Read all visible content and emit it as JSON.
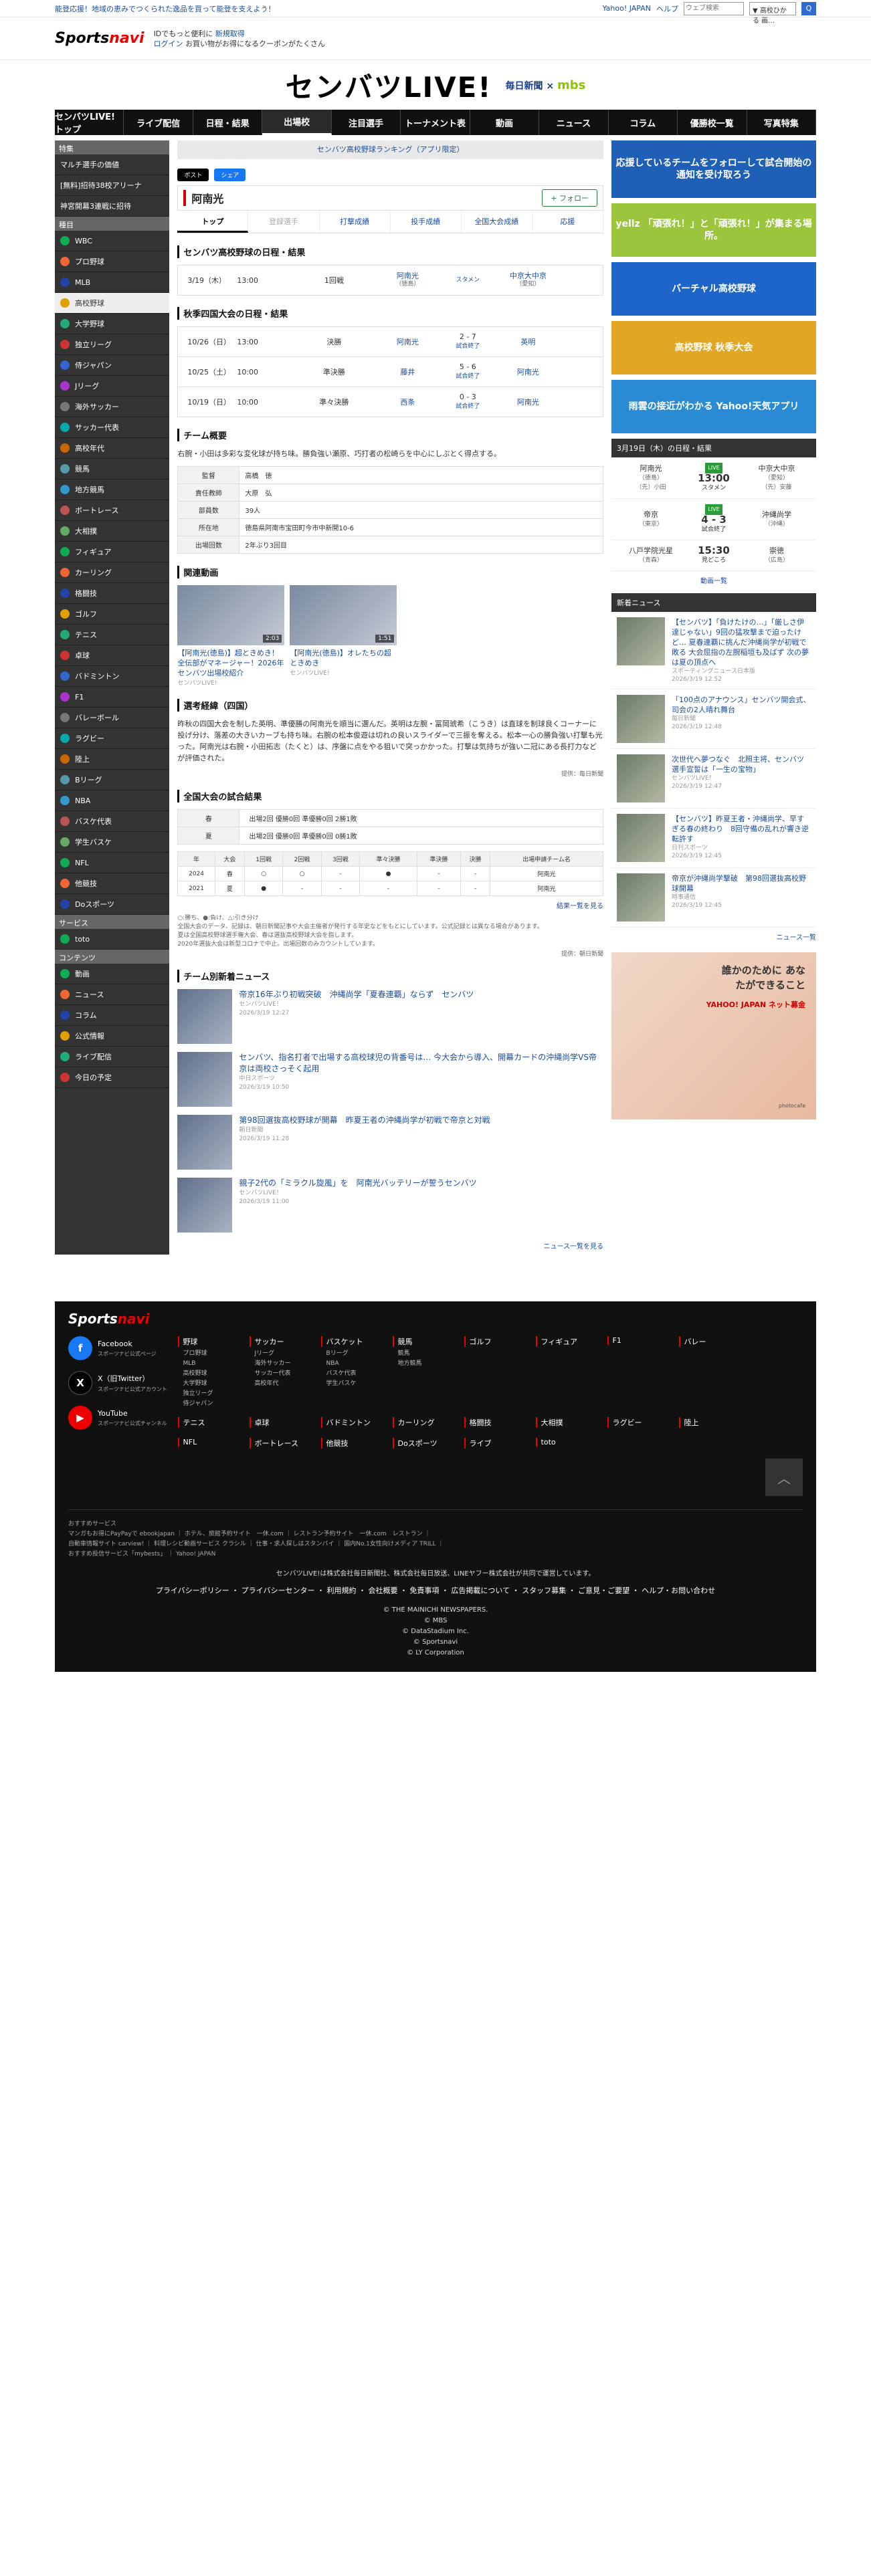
{
  "top": {
    "promo": "能登応援！地域の恵みでつくられた逸品を買って能登を支えよう！",
    "yahoo": "Yahoo! JAPAN",
    "help": "ヘルプ",
    "search_placeholder": "ウェブ検索",
    "search_scope": "▼ 高校ひかる 画…",
    "search_btn": "Q"
  },
  "logo_bar": {
    "logo_a": "Sports",
    "logo_b": "navi",
    "id_line1a": "IDでもっと便利に",
    "id_line1b": "新規取得",
    "id_line2a": "ログイン",
    "id_line2b": "お買い物がお得になるクーポンがたくさん"
  },
  "brand": {
    "title": "センバツLIVE!",
    "partner1": "毎日新聞",
    "times": "×",
    "partner2": "mbs"
  },
  "gnav": [
    "センバツLIVE!トップ",
    "ライブ配信",
    "日程・結果",
    "出場校",
    "注目選手",
    "トーナメント表",
    "動画",
    "ニュース",
    "コラム",
    "優勝校一覧",
    "写真特集"
  ],
  "gnav_active": "出場校",
  "sidebar": {
    "feature_hd": "特集",
    "feature": [
      "マルチ選手の価値",
      "[無料]招待38校アリーナ",
      "神宮開幕3連戦に招待"
    ],
    "sports_hd": "種目",
    "sports": [
      "WBC",
      "プロ野球",
      "MLB",
      "高校野球",
      "大学野球",
      "独立リーグ",
      "侍ジャパン",
      "Jリーグ",
      "海外サッカー",
      "サッカー代表",
      "高校年代",
      "競馬",
      "地方競馬",
      "ボートレース",
      "大相撲",
      "フィギュア",
      "カーリング",
      "格闘技",
      "ゴルフ",
      "テニス",
      "卓球",
      "バドミントン",
      "F1",
      "バレーボール",
      "ラグビー",
      "陸上",
      "Bリーグ",
      "NBA",
      "バスケ代表",
      "学生バスケ",
      "NFL",
      "他競技",
      "Doスポーツ"
    ],
    "sports_active": "高校野球",
    "service_hd": "サービス",
    "service": [
      "toto"
    ],
    "contents_hd": "コンテンツ",
    "contents": [
      "動画",
      "ニュース",
      "コラム",
      "公式情報",
      "ライブ配信",
      "今日の予定"
    ]
  },
  "main": {
    "ranking": "センバツ高校野球ランキング（アプリ限定）",
    "share_x": "ポスト",
    "share_fb": "シェア",
    "team": "阿南光",
    "follow": "+ フォロー",
    "tabs": [
      "トップ",
      "登録選手",
      "打撃成績",
      "投手成績",
      "全国大会成績",
      "応援"
    ],
    "sched_title": "センバツ高校野球の日程・結果",
    "sched": [
      {
        "date": "3/19（木）",
        "time": "13:00",
        "round": "1回戦",
        "home": "阿南光",
        "home_pref": "（徳島）",
        "score": "",
        "status": "スタメン",
        "away": "中京大中京",
        "away_pref": "（愛知）"
      }
    ],
    "fall_title": "秋季四国大会の日程・結果",
    "fall": [
      {
        "date": "10/26（日）",
        "time": "13:00",
        "round": "決勝",
        "home": "阿南光",
        "score": "2 - 7",
        "status": "試合終了",
        "away": "英明"
      },
      {
        "date": "10/25（土）",
        "time": "10:00",
        "round": "準決勝",
        "home": "藤井",
        "score": "5 - 6",
        "status": "試合終了",
        "away": "阿南光"
      },
      {
        "date": "10/19（日）",
        "time": "10:00",
        "round": "準々決勝",
        "home": "西条",
        "score": "0 - 3",
        "status": "試合終了",
        "away": "阿南光"
      }
    ],
    "summary_title": "チーム概要",
    "summary_desc": "右腕・小田は多彩な変化球が持ち味。勝負強い瀬原、巧打者の松崎らを中心にしぶとく得点する。",
    "info": [
      {
        "k": "監督",
        "v": "高橋　徳"
      },
      {
        "k": "責任教師",
        "v": "大原　弘"
      },
      {
        "k": "部員数",
        "v": "39人"
      },
      {
        "k": "所在地",
        "v": "徳島県阿南市宝田町今市中新開10-6"
      },
      {
        "k": "出場回数",
        "v": "2年ぶり3回目"
      }
    ],
    "videos_title": "関連動画",
    "videos": [
      {
        "title": "【阿南光(徳島)】超ときめき！全伝部がマネージャー！2026年センバツ出場校紹介",
        "src": "センバツLIVE!",
        "dur": "2:03"
      },
      {
        "title": "【阿南光(徳島)】オレたちの超ときめき",
        "src": "センバツLIVE!",
        "dur": "1:51"
      }
    ],
    "record_title": "選考経緯（四国）",
    "record": "昨秋の四国大会を制した英明、準優勝の阿南光を順当に選んだ。英明は左腕・冨岡琥希（こうき）は直球を制球良くコーナーに投げ分け、落差の大きいカーブも持ち味。右腕の松本俊遊は切れの良いスライダーで三振を奪える。松本一心の勝負強い打撃も光った。阿南光は右腕・小田拓志（たくと）は、序盤に点をやる狙いで突っかかった。打撃は気持ちが強い二冠にある長打力などが評価された。",
    "record_credit": "提供：毎日新聞",
    "natl_title": "全国大会の試合結果",
    "natl": [
      {
        "k": "春",
        "v": "出場2回 優勝0回 準優勝0回 2勝1敗"
      },
      {
        "k": "夏",
        "v": "出場2回 優勝0回 準優勝0回 0勝1敗"
      }
    ],
    "hist_head": [
      "年",
      "大会",
      "1回戦",
      "2回戦",
      "3回戦",
      "準々決勝",
      "準決勝",
      "決勝",
      "出場申請チーム名"
    ],
    "hist": [
      [
        "2024",
        "春",
        "○",
        "○",
        "-",
        "●",
        "-",
        "-",
        "阿南光"
      ],
      [
        "2021",
        "夏",
        "●",
        "-",
        "-",
        "-",
        "-",
        "-",
        "阿南光"
      ]
    ],
    "hist_more": "結果一覧を見る",
    "notes": [
      "○:勝ち、●:負け、△:引き分け",
      "全国大会のデータ、記録は、朝日新聞記事や大会主催者が発行する年史などをもとにしています。公式記録とは異なる場合があります。",
      "夏は全国高校野球選手権大会、春は選抜高校野球大会を指します。",
      "2020年選抜大会は新型コロナで中止。出場回数のみカウントしています。"
    ],
    "hist_credit": "提供：朝日新聞",
    "news_title": "チーム別新着ニュース",
    "news": [
      {
        "title": "帝京16年ぶり初戦突破　沖縄尚学「夏春連覇」ならず　センバツ",
        "src": "センバツLIVE！",
        "date": "2026/3/19 12:27"
      },
      {
        "title": "センバツ、指名打者で出場する高校球児の背番号は… 今大会から導入、開幕カードの沖縄尚学VS帝京は両校さっそく起用",
        "src": "中日スポーツ",
        "date": "2026/3/19 10:50"
      },
      {
        "title": "第98回選抜高校野球が開幕　昨夏王者の沖縄尚学が初戦で帝京と対戦",
        "src": "朝日新聞",
        "date": "2026/3/19 11:28"
      },
      {
        "title": "親子2代の「ミラクル旋風」を　阿南光バッテリーが誓うセンバツ",
        "src": "センバツLIVE！",
        "date": "2026/3/19 11:00"
      }
    ],
    "news_more": "ニュース一覧を見る"
  },
  "right": {
    "ads": [
      {
        "text": "応援しているチームをフォローして試合開始の通知を受け取ろう",
        "bg": "#1f5fb6"
      },
      {
        "text": "yellz 「頑張れ！」と「頑張れ！」が集まる場所。",
        "bg": "#9bc53d"
      },
      {
        "text": "バーチャル高校野球",
        "bg": "#1d65c9"
      },
      {
        "text": "高校野球 秋季大会",
        "bg": "#e0a624"
      },
      {
        "text": "雨雲の接近がわかる Yahoo!天気アプリ",
        "bg": "#2a8bd4"
      }
    ],
    "sched_hd": "3月19日（木）の日程・結果",
    "games": [
      {
        "home": "阿南光",
        "home_p": "（徳島）",
        "home_note": "（先）小田",
        "live": "LIVE",
        "score": "13:00",
        "status": "スタメン",
        "away": "中京大中京",
        "away_p": "（愛知）",
        "away_note": "（先）安藤"
      },
      {
        "home": "帝京",
        "home_p": "（東京）",
        "home_note": "",
        "live": "LIVE",
        "score": "4 - 3",
        "status": "試合終了",
        "away": "沖縄尚学",
        "away_p": "（沖縄）",
        "away_note": ""
      },
      {
        "home": "八戸学院光星",
        "home_p": "（青森）",
        "home_note": "",
        "live": "",
        "score": "15:30",
        "status": "見どころ",
        "away": "崇徳",
        "away_p": "（広島）",
        "away_note": ""
      }
    ],
    "video_btn": "動画一覧",
    "news_hd": "新着ニュース",
    "news": [
      {
        "title": "【センバツ】「負けたけの…」「厳しさ伊達じゃない」9回の猛攻撃まで迫ったけど… 夏春連覇に挑んだ沖縄尚学が初戦で敗る 大会屈指の左腕稲垣も及ばず 次の夢は夏の頂点へ",
        "src": "スポーティングニュース日本版",
        "date": "2026/3/19 12:52"
      },
      {
        "title": "「100点のアナウンス」センバツ開会式、司会の2人晴れ舞台",
        "src": "毎日新聞",
        "date": "2026/3/19 12:48"
      },
      {
        "title": "次世代へ夢つなぐ　北照主将、センバツ選手宣誓は「一生の宝物」",
        "src": "センバツLIVE！",
        "date": "2026/3/19 12:47"
      },
      {
        "title": "【センバツ】昨夏王者・沖縄尚学、早すぎる春の終わり　8回守備の乱れが響き逆転許す",
        "src": "日刊スポーツ",
        "date": "2026/3/19 12:45"
      },
      {
        "title": "帝京が沖縄尚学撃破　第98回選抜高校野球開幕",
        "src": "時事通信",
        "date": "2026/3/19 12:45"
      }
    ],
    "news_more": "ニュース一覧",
    "ad_bottom": "誰かのために あなたができること",
    "ad_bottom_brand": "YAHOO! JAPAN ネット募金",
    "ad_bottom_credit": "photocafe"
  },
  "footer": {
    "logo_a": "Sports",
    "logo_b": "navi",
    "social": [
      {
        "name": "Facebook",
        "sub": "スポーツナビ公式ページ",
        "color": "#1877f2",
        "ch": "f"
      },
      {
        "name": "X（旧Twitter）",
        "sub": "スポーツナビ公式アカウント",
        "color": "#000",
        "ch": "X"
      },
      {
        "name": "YouTube",
        "sub": "スポーツナビ公式チャンネル",
        "color": "#e00",
        "ch": "▶"
      }
    ],
    "cats": [
      {
        "h": "野球",
        "subs": [
          "プロ野球",
          "MLB",
          "高校野球",
          "大学野球",
          "独立リーグ",
          "侍ジャパン"
        ]
      },
      {
        "h": "サッカー",
        "subs": [
          "Jリーグ",
          "海外サッカー",
          "サッカー代表",
          "高校年代"
        ]
      },
      {
        "h": "バスケット",
        "subs": [
          "Bリーグ",
          "NBA",
          "バスケ代表",
          "学生バスケ"
        ]
      },
      {
        "h": "競馬",
        "subs": [
          "競馬",
          "地方競馬"
        ]
      },
      {
        "h": "ゴルフ",
        "subs": []
      },
      {
        "h": "フィギュア",
        "subs": []
      },
      {
        "h": "F1",
        "subs": []
      },
      {
        "h": "バレー",
        "subs": []
      },
      {
        "h": "テニス",
        "subs": []
      },
      {
        "h": "卓球",
        "subs": []
      },
      {
        "h": "バドミントン",
        "subs": []
      },
      {
        "h": "カーリング",
        "subs": []
      },
      {
        "h": "格闘技",
        "subs": []
      },
      {
        "h": "大相撲",
        "subs": []
      },
      {
        "h": "ラグビー",
        "subs": []
      },
      {
        "h": "陸上",
        "subs": []
      },
      {
        "h": "NFL",
        "subs": []
      },
      {
        "h": "ボートレース",
        "subs": []
      },
      {
        "h": "他競技",
        "subs": []
      },
      {
        "h": "Doスポーツ",
        "subs": []
      },
      {
        "h": "ライブ",
        "subs": []
      },
      {
        "h": "toto",
        "subs": []
      }
    ],
    "totop": "︿",
    "svc_hd": "おすすめサービス",
    "svc1": "マンガもお得にPayPayで ebookjapan ｜ ホテル、旅館予約サイト　一休.com ｜ レストラン予約サイト　一休.com　レストラン ｜",
    "svc2": "自動車情報サイト carview! ｜ 料理レシピ動画サービス クラシル ｜ 仕事・求人探しはスタンバイ ｜ 国内No.1女性向けメディア TRILL ｜",
    "svc3": "おすすめ投信サービス「mybests」 ｜ Yahoo! JAPAN",
    "operator": "センバツLIVE!は株式会社毎日新聞社、株式会社毎日放送、LINEヤフー株式会社が共同で運営しています。",
    "links": "プライバシーポリシー ・ プライバシーセンター ・ 利用規約 ・ 会社概要 ・ 免責事項 ・ 広告掲載について ・ スタッフ募集 ・ ご意見・ご要望 ・ ヘルプ・お問い合わせ",
    "copy": [
      "© THE MAINICHI NEWSPAPERS.",
      "© MBS",
      "© DataStadium Inc.",
      "© Sportsnavi",
      "© LY Corporation"
    ]
  }
}
